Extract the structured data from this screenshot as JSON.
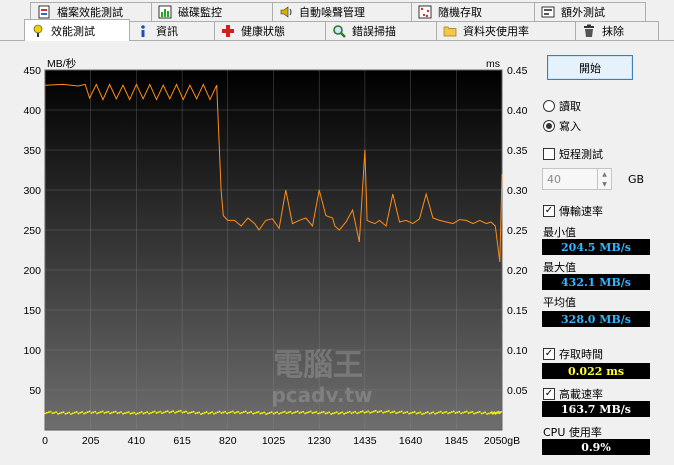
{
  "tabs_top": [
    {
      "label": "檔案效能測試",
      "icon": "file-benchmark-icon"
    },
    {
      "label": "磁碟監控",
      "icon": "disk-monitor-icon"
    },
    {
      "label": "自動噪聲管理",
      "icon": "speaker-icon"
    },
    {
      "label": "隨機存取",
      "icon": "random-access-icon"
    },
    {
      "label": "額外測試",
      "icon": "extra-tests-icon"
    }
  ],
  "tabs_bottom": [
    {
      "label": "效能測試",
      "icon": "benchmark-icon",
      "active": true
    },
    {
      "label": "資訊",
      "icon": "info-icon"
    },
    {
      "label": "健康狀態",
      "icon": "health-icon"
    },
    {
      "label": "錯誤掃描",
      "icon": "error-scan-icon"
    },
    {
      "label": "資料夾使用率",
      "icon": "folder-usage-icon"
    },
    {
      "label": "抹除",
      "icon": "erase-icon"
    }
  ],
  "controls": {
    "start_label": "開始",
    "read_label": "讀取",
    "write_label": "寫入",
    "mode_selected": "write",
    "short_test_label": "短程測試",
    "short_test_checked": false,
    "size_value": "40",
    "size_unit": "GB",
    "transfer_rate_label": "傳輸速率",
    "transfer_rate_checked": true,
    "min_label": "最小值",
    "min_value": "204.5 MB/s",
    "max_label": "最大值",
    "max_value": "432.1 MB/s",
    "avg_label": "平均值",
    "avg_value": "328.0 MB/s",
    "access_time_label": "存取時間",
    "access_time_checked": true,
    "access_time_value": "0.022 ms",
    "burst_rate_label": "高載速率",
    "burst_rate_checked": true,
    "burst_rate_value": "163.7 MB/s",
    "cpu_label": "CPU 使用率",
    "cpu_value": "0.9%"
  },
  "watermark": {
    "line1": "電腦王",
    "line2": "pcadv.tw"
  },
  "colors": {
    "transfer_line": "#ff8c1a",
    "access_points": "#ffff00",
    "plot_bg_top": "#000000",
    "plot_bg_bottom": "#6e6e6e",
    "grid": "#8a8a8a"
  },
  "chart_data": {
    "type": "line",
    "ylabel_left": "MB/秒",
    "ylabel_right": "ms",
    "xunit": "gB",
    "x_ticks": [
      0,
      205,
      410,
      615,
      820,
      1025,
      1230,
      1435,
      1640,
      1845,
      2050
    ],
    "y_ticks_left": [
      50,
      100,
      150,
      200,
      250,
      300,
      350,
      400,
      450
    ],
    "y_ticks_right": [
      "0.05",
      "0.10",
      "0.15",
      "0.20",
      "0.25",
      "0.30",
      "0.35",
      "0.40",
      "0.45"
    ],
    "xlim": [
      0,
      2050
    ],
    "ylim_left": [
      0,
      450
    ],
    "ylim_right": [
      0,
      0.45
    ],
    "grid": true,
    "series": [
      {
        "name": "傳輸速率",
        "axis": "left",
        "x": [
          0,
          80,
          150,
          180,
          200,
          230,
          260,
          290,
          320,
          350,
          380,
          410,
          440,
          470,
          500,
          530,
          560,
          590,
          620,
          650,
          680,
          710,
          740,
          770,
          790,
          800,
          820,
          850,
          880,
          910,
          940,
          960,
          990,
          1020,
          1050,
          1080,
          1110,
          1140,
          1170,
          1200,
          1230,
          1260,
          1290,
          1300,
          1320,
          1350,
          1380,
          1410,
          1435,
          1445,
          1460,
          1480,
          1500,
          1530,
          1560,
          1590,
          1620,
          1650,
          1680,
          1710,
          1740,
          1770,
          1800,
          1830,
          1860,
          1890,
          1920,
          1950,
          1980,
          2000,
          2020,
          2040,
          2050
        ],
        "y": [
          431,
          432,
          430,
          432,
          415,
          432,
          413,
          432,
          414,
          431,
          413,
          432,
          414,
          432,
          413,
          431,
          414,
          432,
          413,
          431,
          414,
          432,
          413,
          431,
          300,
          268,
          262,
          262,
          255,
          265,
          258,
          250,
          262,
          264,
          252,
          300,
          258,
          262,
          265,
          255,
          300,
          268,
          265,
          255,
          250,
          260,
          275,
          235,
          350,
          262,
          260,
          258,
          262,
          255,
          295,
          260,
          262,
          258,
          264,
          295,
          265,
          262,
          260,
          258,
          263,
          262,
          258,
          262,
          258,
          260,
          255,
          210,
          320
        ]
      },
      {
        "name": "存取時間",
        "axis": "right",
        "style": "scatter",
        "x": [
          0,
          100,
          200,
          300,
          400,
          500,
          600,
          700,
          800,
          900,
          1000,
          1100,
          1200,
          1300,
          1400,
          1500,
          1600,
          1700,
          1800,
          1900,
          2000,
          2050
        ],
        "y": [
          0.022,
          0.021,
          0.022,
          0.022,
          0.021,
          0.022,
          0.023,
          0.021,
          0.022,
          0.022,
          0.021,
          0.022,
          0.022,
          0.021,
          0.022,
          0.023,
          0.022,
          0.021,
          0.022,
          0.022,
          0.021,
          0.022
        ]
      }
    ]
  }
}
